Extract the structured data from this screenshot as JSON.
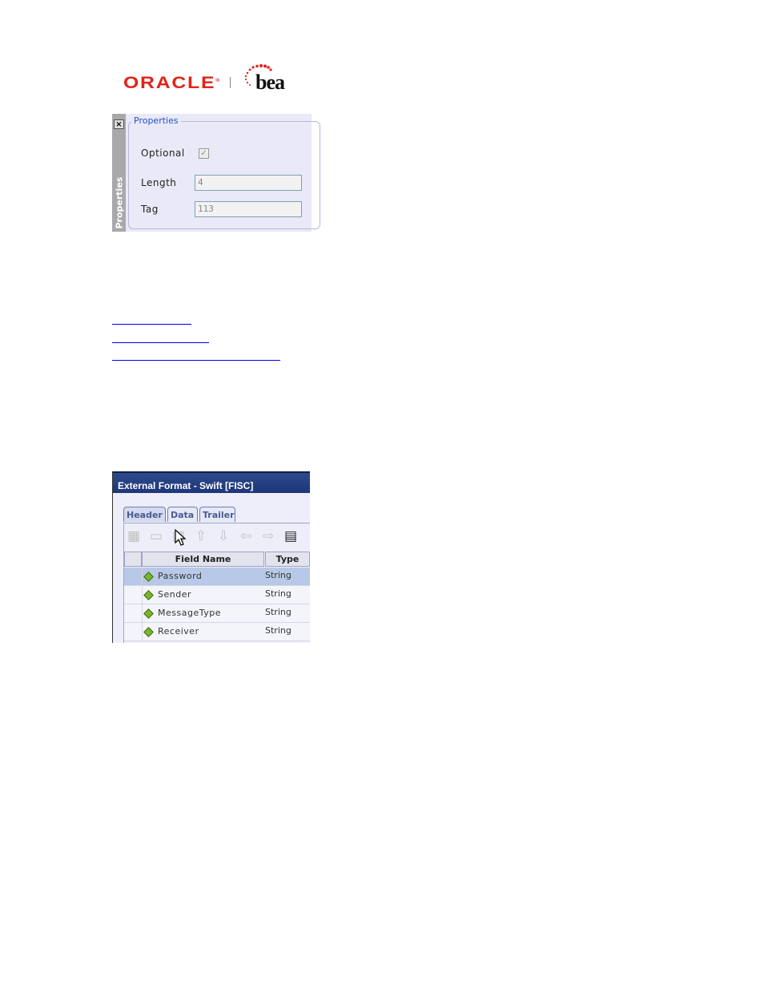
{
  "logo": {
    "oracle_text": "ORACLE",
    "oracle_reg": "®",
    "bea_text": "bea",
    "colors": {
      "oracle": "#e2231a",
      "bea": "#111111"
    }
  },
  "properties_panel": {
    "sidebar_label": "Properties",
    "close_icon": "×",
    "legend": "Properties",
    "fields": [
      {
        "label": "Optional",
        "type": "checkbox",
        "checked": true,
        "disabled": true,
        "check_glyph": "✓"
      },
      {
        "label": "Length",
        "type": "text",
        "value": "4"
      },
      {
        "label": "Tag",
        "type": "text",
        "value": "113"
      }
    ]
  },
  "links": [
    {
      "name": "link-1"
    },
    {
      "name": "link-2"
    },
    {
      "name": "link-3"
    }
  ],
  "external_format": {
    "title": "External Format - Swift [FISC]",
    "tabs": [
      {
        "label": "Header",
        "active": true
      },
      {
        "label": "Data",
        "active": false
      },
      {
        "label": "Trailer",
        "active": false
      }
    ],
    "toolbar": [
      {
        "icon": "add-table-icon",
        "glyph": "▦",
        "enabled": false
      },
      {
        "icon": "add-folder-icon",
        "glyph": "▭",
        "enabled": false
      },
      {
        "icon": "add-field-icon",
        "glyph": "▦",
        "enabled": false
      },
      {
        "icon": "move-up-icon",
        "glyph": "⇧",
        "enabled": false
      },
      {
        "icon": "move-down-icon",
        "glyph": "⇩",
        "enabled": false
      },
      {
        "icon": "move-left-icon",
        "glyph": "⇦",
        "enabled": false
      },
      {
        "icon": "move-right-icon",
        "glyph": "⇨",
        "enabled": false
      },
      {
        "icon": "properties-icon",
        "glyph": "▤",
        "enabled": true
      }
    ],
    "columns": [
      "Field Name",
      "Type"
    ],
    "rows": [
      {
        "name": "Password",
        "type": "String",
        "selected": true
      },
      {
        "name": "Sender",
        "type": "String",
        "selected": false
      },
      {
        "name": "MessageType",
        "type": "String",
        "selected": false
      },
      {
        "name": "Receiver",
        "type": "String",
        "selected": false
      }
    ]
  }
}
